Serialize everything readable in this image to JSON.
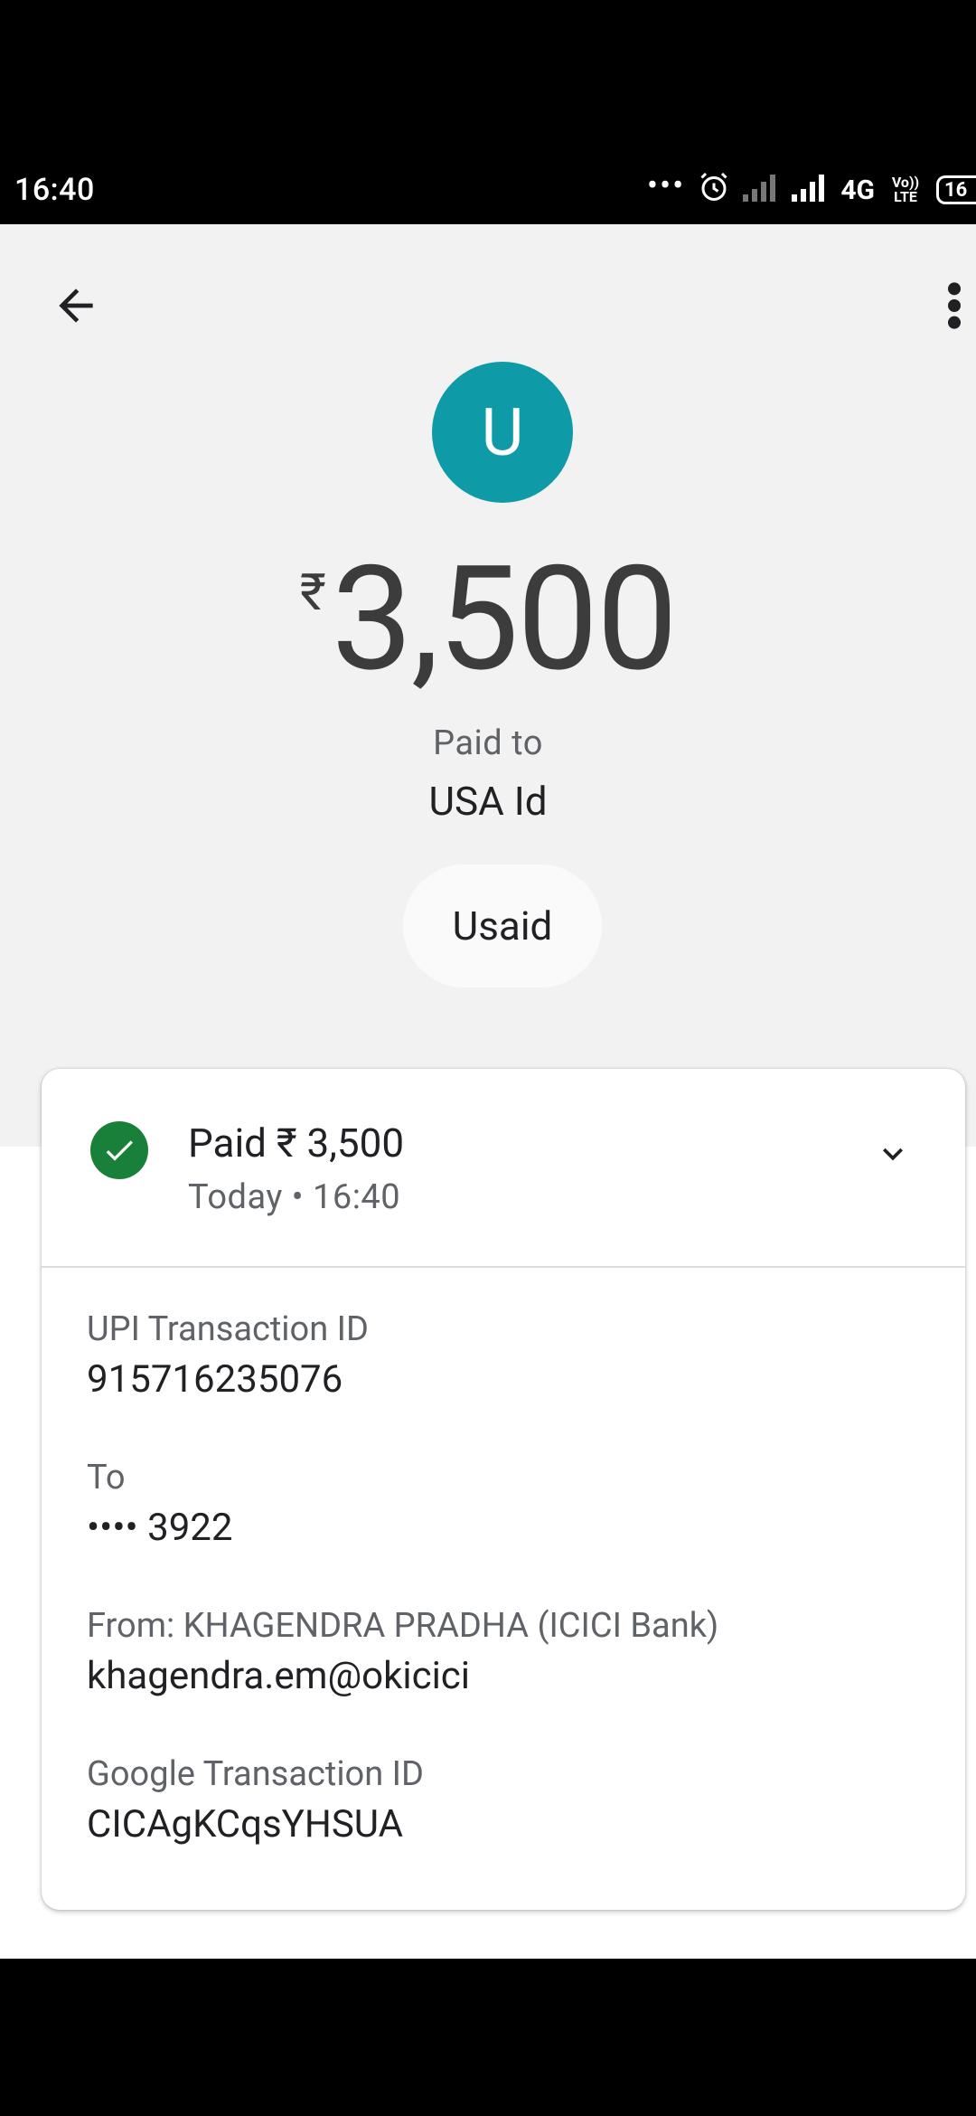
{
  "status_bar": {
    "time": "16:40",
    "dots": "•••",
    "network": "4G",
    "volte": "Vo)) LTE",
    "battery": "16"
  },
  "header": {
    "back_icon": "arrow-left-icon",
    "more_icon": "more-vert-icon"
  },
  "payee": {
    "avatar_letter": "U",
    "avatar_color": "#0f9aa8",
    "currency_symbol": "₹",
    "amount": "3,500",
    "paid_to_label": "Paid to",
    "name": "USA Id",
    "chip_label": "Usaid"
  },
  "transaction": {
    "status": "Paid ₹ 3,500",
    "timestamp": "Today • 16:40",
    "status_color": "#188038",
    "details": [
      {
        "label": "UPI Transaction ID",
        "value": "915716235076"
      },
      {
        "label": "To",
        "value": "•••• 3922"
      },
      {
        "label": "From: KHAGENDRA PRADHA (ICICI Bank)",
        "value": "khagendra.em@okicici"
      },
      {
        "label": "Google Transaction ID",
        "value": "CICAgKCqsYHSUA"
      }
    ]
  }
}
